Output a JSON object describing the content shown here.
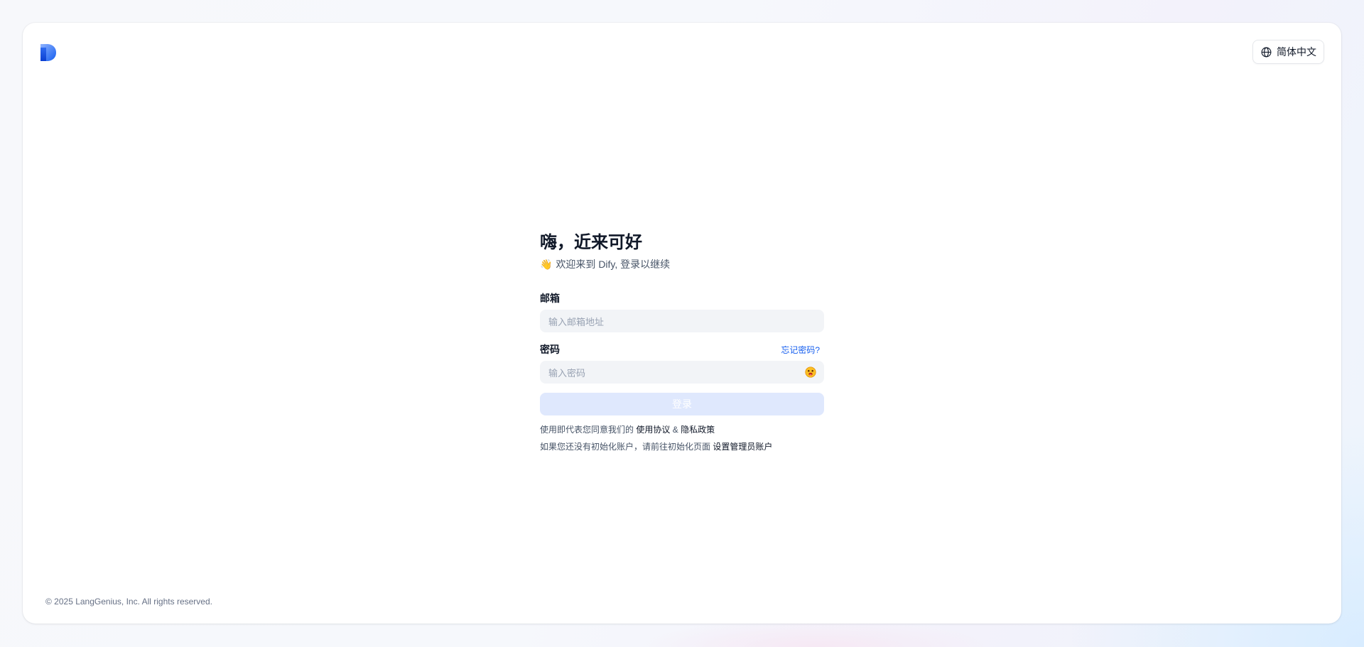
{
  "header": {
    "logo_icon": "dify-logo-icon",
    "language_label": "简体中文",
    "language_icon": "globe-icon"
  },
  "login": {
    "title": "嗨，近来可好",
    "wave_emoji": "👋",
    "subtitle": "欢迎来到 Dify, 登录以继续",
    "email": {
      "label": "邮箱",
      "placeholder": "输入邮箱地址"
    },
    "password": {
      "label": "密码",
      "forgot_label": "忘记密码?",
      "placeholder": "输入密码",
      "toggle_icon": "show-password-emoji-icon"
    },
    "submit_label": "登录",
    "terms": {
      "prefix": "使用即代表您同意我们的",
      "terms_link": "使用协议",
      "and": "&",
      "privacy_link": "隐私政策"
    },
    "init": {
      "prefix": "如果您还没有初始化账户，请前往初始化页面",
      "link": "设置管理员账户"
    }
  },
  "footer": {
    "copyright": "© 2025 LangGenius, Inc. All rights reserved."
  },
  "colors": {
    "primary": "#155eef",
    "button_disabled": "#dfe8fd",
    "input_bg": "#f2f4f7",
    "text_primary": "#101828",
    "text_secondary": "#475467"
  }
}
